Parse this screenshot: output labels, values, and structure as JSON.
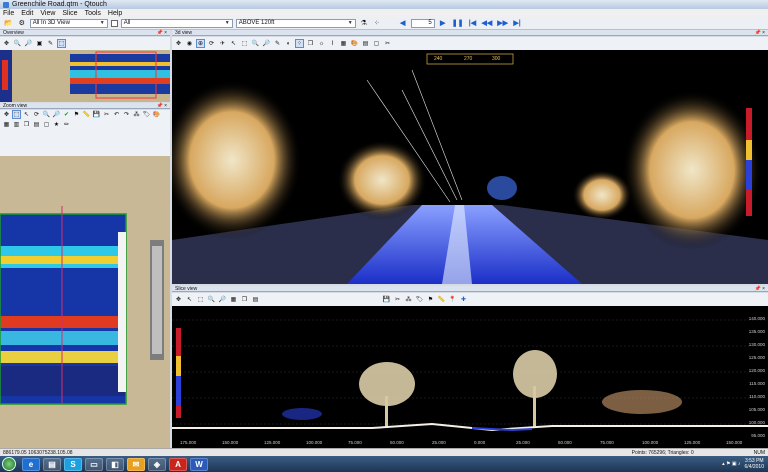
{
  "window": {
    "title": "Greenchile Road.qtm - Qtouch"
  },
  "menu": [
    "File",
    "Edit",
    "View",
    "Slice",
    "Tools",
    "Help"
  ],
  "toolbar": {
    "view_select": "All In 3D View",
    "all_checkbox_label": "All",
    "class_select": "ABOVE 120ft",
    "frame_value": "5"
  },
  "overview": {
    "title": "Overview"
  },
  "view3d": {
    "title": "3d view",
    "compass": [
      "240",
      "270",
      "300"
    ]
  },
  "zoomview": {
    "title": "Zoom view"
  },
  "sliceview": {
    "title": "Slice view",
    "x_ticks": [
      "175.000",
      "150.000",
      "125.000",
      "100.000",
      "75.000",
      "50.000",
      "25.000",
      "0.000",
      "25.000",
      "50.000",
      "75.000",
      "100.000",
      "125.000",
      "150.000"
    ],
    "y_ticks": [
      "140.000",
      "135.000",
      "130.000",
      "125.000",
      "120.000",
      "115.000",
      "110.000",
      "105.000",
      "100.000",
      "95.000"
    ]
  },
  "status": {
    "coords": "886179.05 1063075238.105.08",
    "points": "Points: 765296; Triangles: 0",
    "mode": "NUM"
  },
  "taskbar": {
    "time": "3:53 PM",
    "date": "6/4/2010"
  },
  "colors": {
    "panel_bg": "#000000",
    "chrome": "#eceff4",
    "accent": "#1c5fd0",
    "zoom_bg": "#c8b896"
  }
}
